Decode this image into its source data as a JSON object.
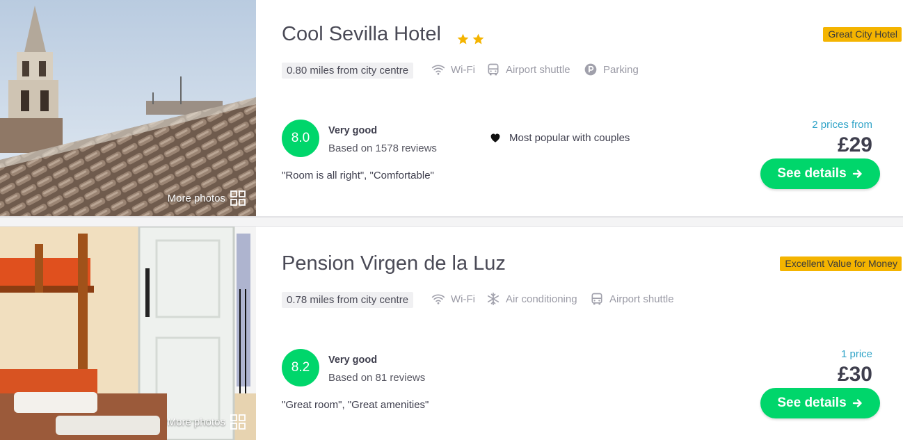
{
  "hotels": [
    {
      "name": "Cool Sevilla Hotel",
      "stars": 2,
      "badge": "Great City Hotel",
      "distance": "0.80 miles from city centre",
      "amenities": [
        "Wi-Fi",
        "Airport shuttle",
        "Parking"
      ],
      "score": "8.0",
      "rating_label": "Very good",
      "reviews": "Based on 1578 reviews",
      "quote": "\"Room is all right\", \"Comfortable\"",
      "popular": "Most popular with couples",
      "prices_from": "2 prices from",
      "price": "£29",
      "cta": "See details",
      "more_photos": "More photos"
    },
    {
      "name": "Pension Virgen de la Luz",
      "badge": "Excellent Value for Money",
      "distance": "0.78 miles from city centre",
      "amenities": [
        "Wi-Fi",
        "Air conditioning",
        "Airport shuttle"
      ],
      "score": "8.2",
      "rating_label": "Very good",
      "reviews": "Based on 81 reviews",
      "quote": "\"Great room\", \"Great amenities\"",
      "prices_from": "1 price",
      "price": "£30",
      "cta": "See details",
      "more_photos": "More photos"
    }
  ],
  "colors": {
    "score_green": "#00d66b",
    "badge_yellow": "#f4b400",
    "star_yellow": "#f4b400",
    "link_blue": "#2fa3c7"
  },
  "icons": [
    "wifi-icon",
    "bus-icon",
    "parking-icon",
    "snowflake-icon",
    "heart-icon",
    "arrow-right-icon",
    "grid-icon",
    "star-icon"
  ]
}
